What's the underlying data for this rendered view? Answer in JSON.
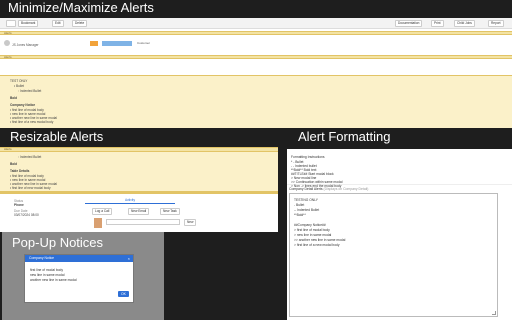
{
  "captions": {
    "minimize": "Minimize/Maximize Alerts",
    "resizable": "Resizable Alerts",
    "formatting": "Alert Formatting",
    "popup": "Pop-Up Notices"
  },
  "toolbar": {
    "items": [
      "",
      "Bookmark",
      "Edit",
      "Delete"
    ],
    "right_items": [
      "Documentation",
      "Print",
      "Child Jobs",
      "Report"
    ]
  },
  "minimize_panel": {
    "alert_bar_label": "Alerts",
    "record_line": "JS Jones Manager",
    "tag_orange": "",
    "tag_blue": "",
    "tag_name": "Customer",
    "second_bar_label": "Alerts",
    "body": {
      "line1": "TEST ONLY",
      "line2": "• Bullet",
      "line3": "◦ Indented Bullet",
      "line4": "Bold",
      "line5": "Company Notice",
      "line6": "• first line of modal body",
      "line7": "• new line in same modal",
      "line8": "• another new line in same modal",
      "line9": "• first line of a new modal body"
    }
  },
  "resizable_panel": {
    "bar_label": "Alerts",
    "line1": "◦ Indented Bullet",
    "line2": "Bold",
    "line3": "Table Details",
    "line4": "• first line of modal body",
    "line5": "• new line in same modal",
    "line6": "• another new line in same modal",
    "line7": "• first line of new modal body",
    "sub_left1": "Status",
    "sub_left2": "Phone",
    "sub_left3": "Due Date",
    "sub_left4": "03/07/2024 08:00",
    "tab": "Activity",
    "btn1": "Log a Call",
    "btn2": "New Email",
    "btn3": "New Task",
    "sub_btn": "New",
    "input_placeholder": ""
  },
  "formatting_panel": {
    "instructions_title": "Formatting Instructions",
    "rules": [
      "* - Bullet",
      "- - Indented bullet",
      "**Bold** Bold text",
      "##TITLE## Start modal block",
      "> New modal line",
      ">> Continuation within same modal",
      "> Non -> lines end the modal body"
    ],
    "field_label": "Company Detail Alerts",
    "field_hint": "(Displays on Company Detail)",
    "textarea_lines": [
      "TESTING ONLY",
      "- Bullet",
      "-- Indented Bullet",
      "**Bold**",
      "",
      "##Company Notice##",
      "> first line of modal body",
      "> new line in same modal",
      ">> another new line in same modal",
      "> first line of a new modal body"
    ]
  },
  "popup_panel": {
    "modal_title": "Company Notice",
    "close_icon": "×",
    "lines": [
      "first line of modal body",
      "new line in same modal",
      "another new line in same modal"
    ],
    "ok_label": "OK"
  },
  "colors": {
    "alert_yellow": "#fbf1c9",
    "alert_border": "#e2c466",
    "modal_blue": "#2e6fd6",
    "tag_orange": "#f2a33a",
    "tag_blue": "#7fb3e6"
  }
}
